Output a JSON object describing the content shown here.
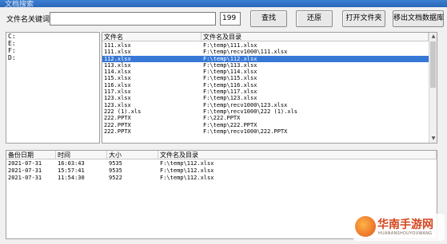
{
  "window": {
    "title": "文档搜索"
  },
  "toolbar": {
    "keyword_label": "文件名关键词",
    "keyword_value": "",
    "count": "199",
    "search_label": "查找",
    "restore_label": "还原",
    "open_folder_label": "打开文件夹",
    "remove_db_label": "移出文档数据库"
  },
  "drives": [
    "C:",
    "E:",
    "F:",
    "D:"
  ],
  "file_grid": {
    "columns": [
      "文件名",
      "文件名及目录"
    ],
    "rows": [
      {
        "name": "111.xlsx",
        "path": "F:\\temp\\111.xlsx",
        "selected": false
      },
      {
        "name": "111.xlsx",
        "path": "F:\\temp\\recv1000\\111.xlsx",
        "selected": false
      },
      {
        "name": "112.xlsx",
        "path": "F:\\temp\\112.xlsx",
        "selected": true
      },
      {
        "name": "113.xlsx",
        "path": "F:\\temp\\113.xlsx",
        "selected": false
      },
      {
        "name": "114.xlsx",
        "path": "F:\\temp\\114.xlsx",
        "selected": false
      },
      {
        "name": "115.xlsx",
        "path": "F:\\temp\\115.xlsx",
        "selected": false
      },
      {
        "name": "116.xlsx",
        "path": "F:\\temp\\116.xlsx",
        "selected": false
      },
      {
        "name": "117.xlsx",
        "path": "F:\\temp\\117.xlsx",
        "selected": false
      },
      {
        "name": "123.xlsx",
        "path": "F:\\temp\\123.xlsx",
        "selected": false
      },
      {
        "name": "123.xlsx",
        "path": "F:\\temp\\recv1000\\123.xlsx",
        "selected": false
      },
      {
        "name": "222 (1).xls",
        "path": "F:\\temp\\recv1000\\222 (1).xls",
        "selected": false
      },
      {
        "name": "222.PPTX",
        "path": "F:\\222.PPTX",
        "selected": false
      },
      {
        "name": "222.PPTX",
        "path": "F:\\temp\\222.PPTX",
        "selected": false
      },
      {
        "name": "222.PPTX",
        "path": "F:\\temp\\recv1000\\222.PPTX",
        "selected": false
      }
    ]
  },
  "history": {
    "columns": [
      "备份日期",
      "时间",
      "大小",
      "文件名及目录"
    ],
    "rows": [
      {
        "date": "2021-07-31",
        "time": "16:03:43",
        "size": "9535",
        "path": "F:\\temp\\112.xlsx"
      },
      {
        "date": "2021-07-31",
        "time": "15:57:41",
        "size": "9535",
        "path": "F:\\temp\\112.xlsx"
      },
      {
        "date": "2021-07-31",
        "time": "11:54:30",
        "size": "9522",
        "path": "F:\\temp\\112.xlsx"
      }
    ]
  },
  "watermark": {
    "brand": "华南手游网",
    "sub": "HUANANSHOUYOUWANG"
  },
  "colors": {
    "selection": "#3778d6",
    "titlebar": "#2a66b8",
    "brand": "#d2451e"
  }
}
